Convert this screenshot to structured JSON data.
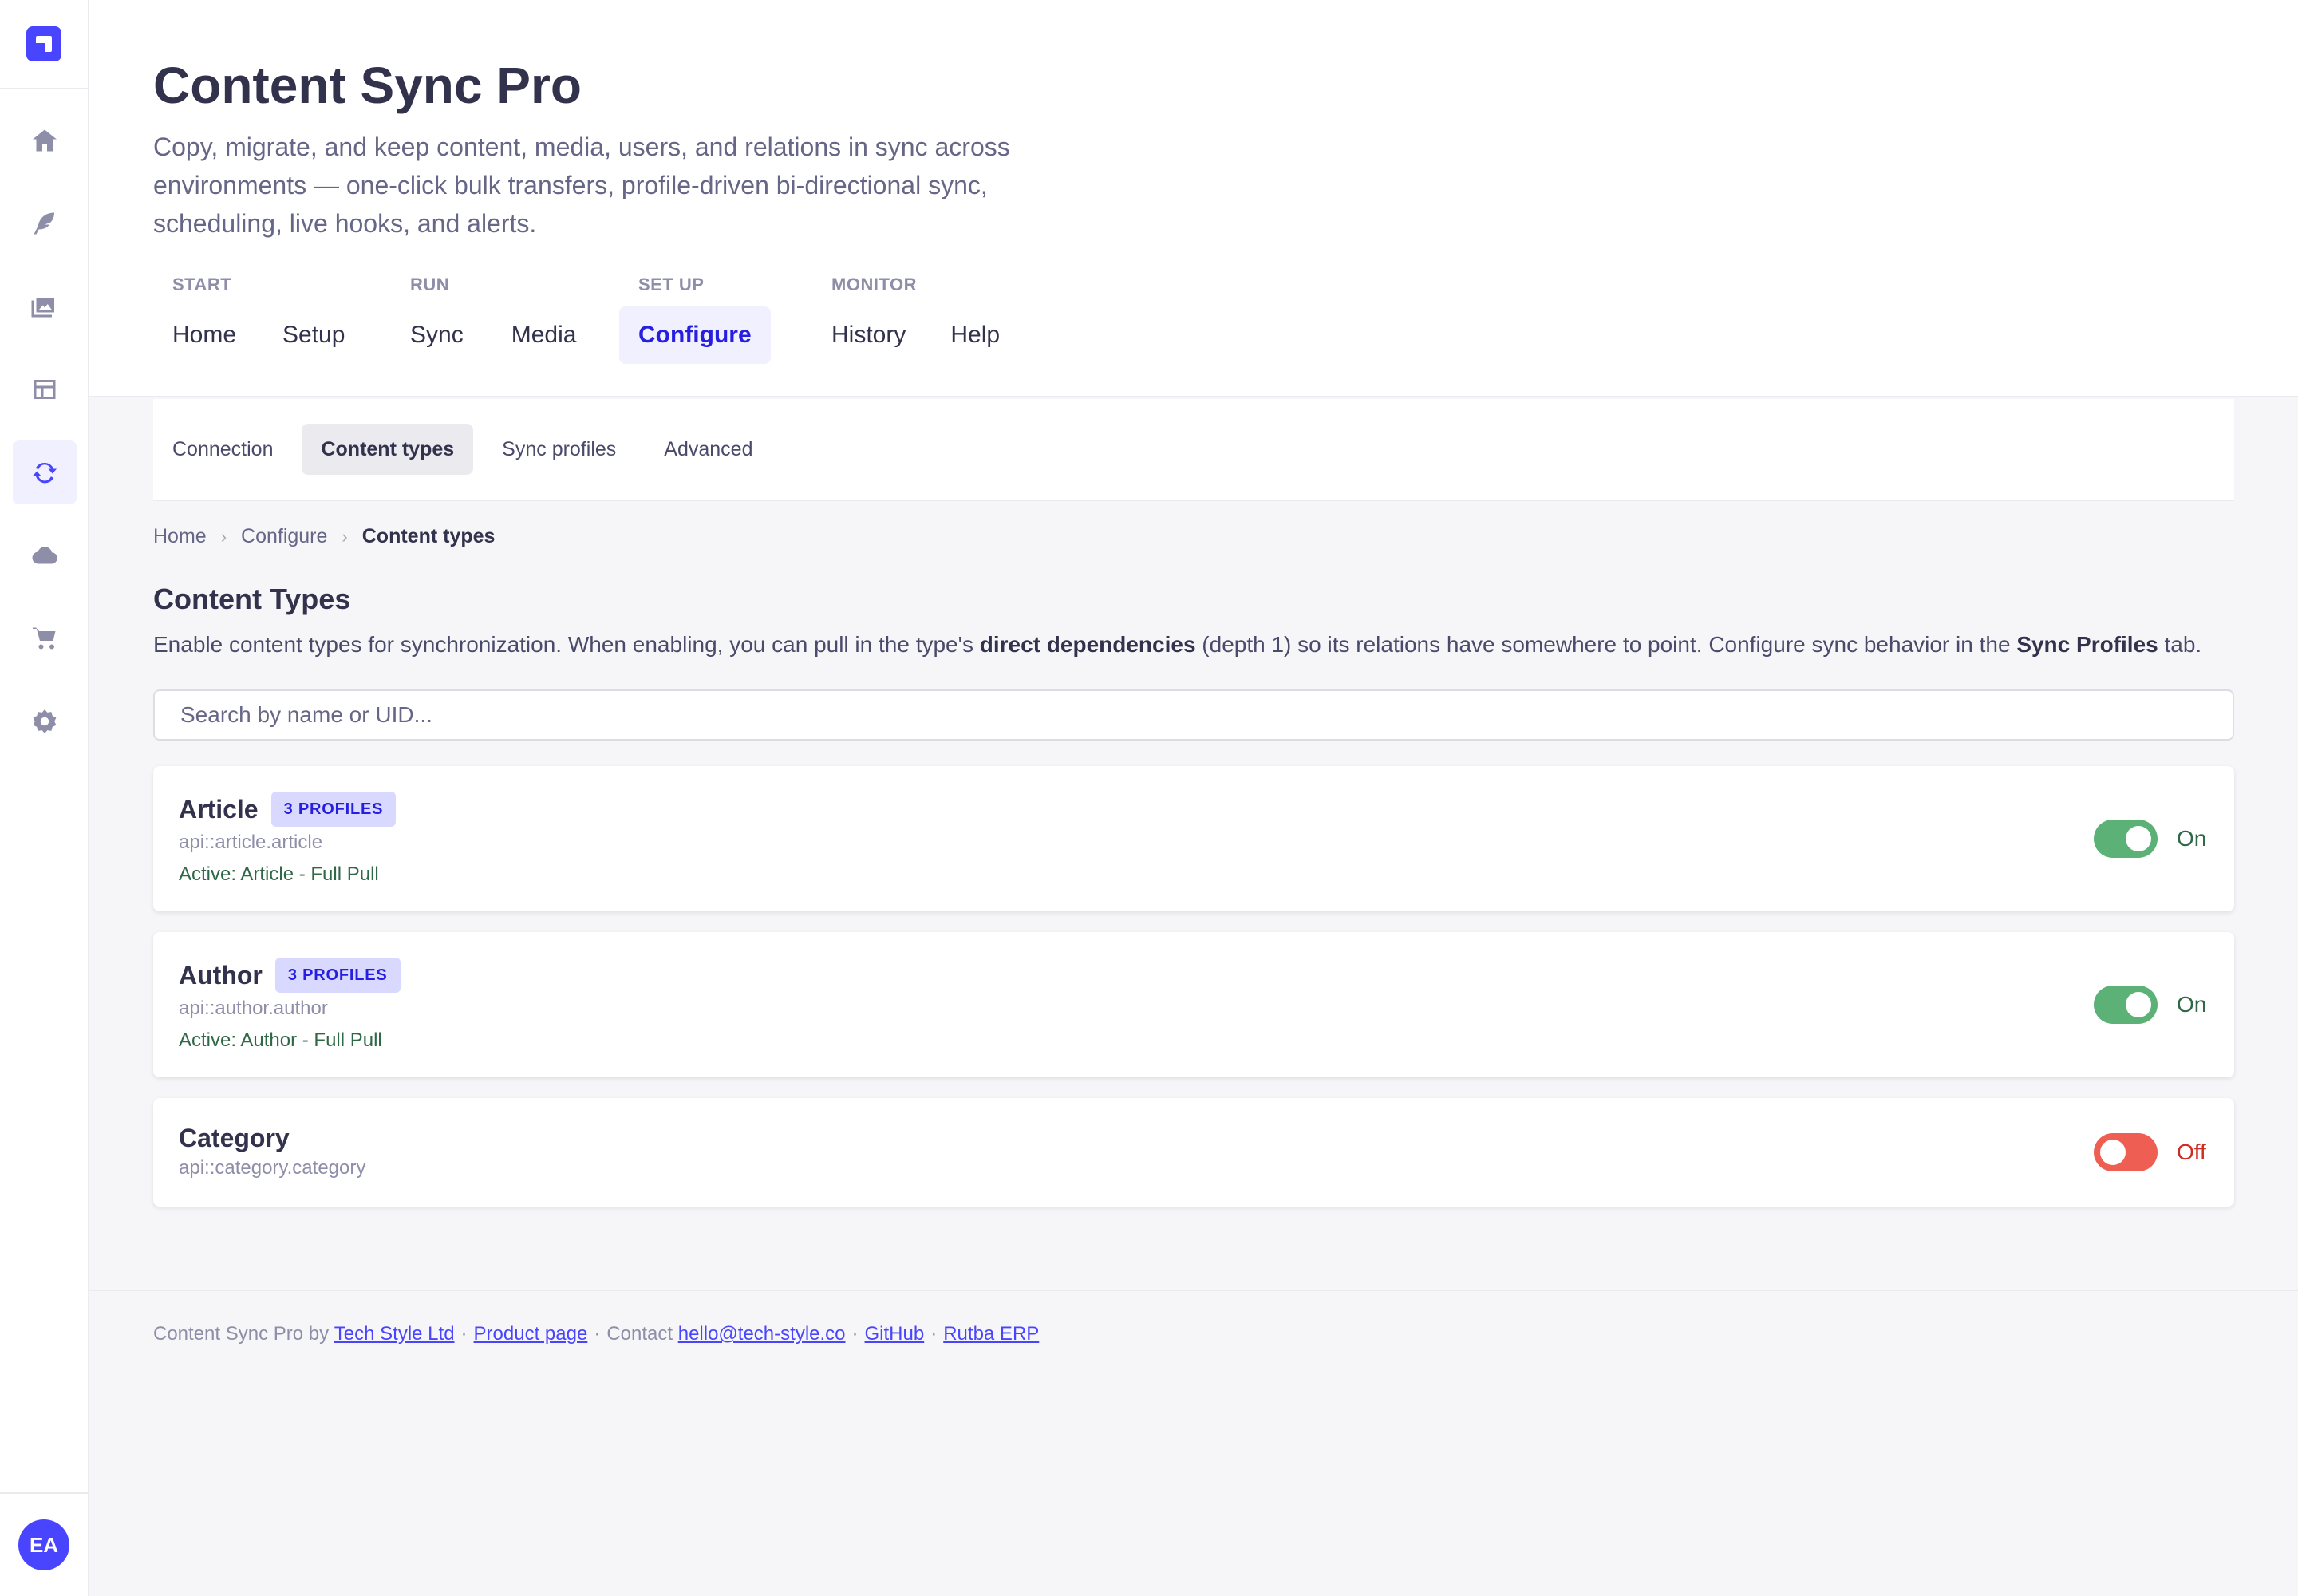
{
  "app": {
    "title": "Content Sync Pro",
    "description": "Copy, migrate, and keep content, media, users, and relations in sync across environments — one-click bulk transfers, profile-driven bi-directional sync, scheduling, live hooks, and alerts."
  },
  "rail": {
    "items": [
      {
        "icon": "home-icon"
      },
      {
        "icon": "feather-icon"
      },
      {
        "icon": "media-library-icon"
      },
      {
        "icon": "layout-icon"
      },
      {
        "icon": "sync-icon",
        "active": true
      },
      {
        "icon": "cloud-icon"
      },
      {
        "icon": "cart-icon"
      },
      {
        "icon": "settings-icon"
      }
    ],
    "avatar_initials": "EA"
  },
  "nav": {
    "groups": [
      {
        "label": "START",
        "items": [
          "Home",
          "Setup"
        ]
      },
      {
        "label": "RUN",
        "items": [
          "Sync",
          "Media"
        ]
      },
      {
        "label": "SET UP",
        "items": [
          "Configure"
        ]
      },
      {
        "label": "MONITOR",
        "items": [
          "History",
          "Help"
        ]
      }
    ],
    "active": "Configure"
  },
  "subtabs": {
    "items": [
      "Connection",
      "Content types",
      "Sync profiles",
      "Advanced"
    ],
    "active": "Content types"
  },
  "breadcrumb": [
    "Home",
    "Configure",
    "Content types"
  ],
  "section": {
    "title": "Content Types",
    "desc_1": "Enable content types for synchronization. When enabling, you can pull in the type's ",
    "desc_bold_1": "direct dependencies",
    "desc_2": " (depth 1) so its relations have somewhere to point. Configure sync behavior in the ",
    "desc_bold_2": "Sync Profiles",
    "desc_3": " tab."
  },
  "search": {
    "placeholder": "Search by name or UID...",
    "value": ""
  },
  "content_types": [
    {
      "name": "Article",
      "badge": "3 PROFILES",
      "uid": "api::article.article",
      "active": "Active: Article - Full Pull",
      "enabled": true,
      "state_label": "On"
    },
    {
      "name": "Author",
      "badge": "3 PROFILES",
      "uid": "api::author.author",
      "active": "Active: Author - Full Pull",
      "enabled": true,
      "state_label": "On"
    },
    {
      "name": "Category",
      "badge": "",
      "uid": "api::category.category",
      "active": "",
      "enabled": false,
      "state_label": "Off"
    }
  ],
  "footer": {
    "prefix": "Content Sync Pro by",
    "company_link": "Tech Style Ltd",
    "product_link": "Product page",
    "contact_label": "Contact",
    "email_link": "hello@tech-style.co",
    "github_link": "GitHub",
    "erp_link": "Rutba ERP"
  },
  "colors": {
    "accent": "#4945ff",
    "toggle_on": "#5cb176",
    "toggle_off": "#ee5e52"
  }
}
